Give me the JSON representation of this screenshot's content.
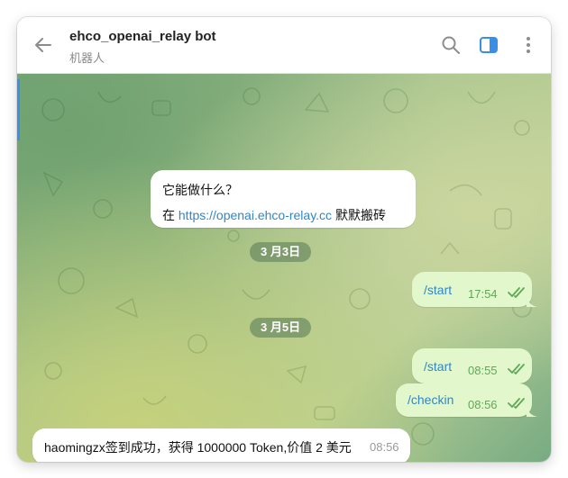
{
  "header": {
    "title": "ehco_openai_relay bot",
    "subtitle": "机器人",
    "icons": [
      "back-arrow-icon",
      "search-icon",
      "sidebar-toggle-icon",
      "more-vert-icon"
    ],
    "accent_color": "#3a8ee6"
  },
  "info_message": {
    "line1": "它能做什么？",
    "line2_prefix": "在 ",
    "link": "https://openai.ehco-relay.cc",
    "line2_suffix": " 默默搬砖"
  },
  "dates": [
    "3 月3日",
    "3 月5日"
  ],
  "messages": [
    {
      "direction": "outgoing",
      "text": "/start",
      "time": "17:54",
      "status": "read"
    },
    {
      "direction": "outgoing",
      "text": "/start",
      "time": "08:55",
      "status": "read"
    },
    {
      "direction": "outgoing",
      "text": "/checkin",
      "time": "08:56",
      "status": "read"
    },
    {
      "direction": "incoming",
      "text": "haomingzx签到成功，获得 1000000 Token,价值 2 美元",
      "time": "08:56"
    }
  ],
  "colors": {
    "outgoing_bubble": "#e2f7cb",
    "incoming_bubble": "#ffffff",
    "link": "#2f87c9",
    "read_check": "#5fa85a"
  }
}
